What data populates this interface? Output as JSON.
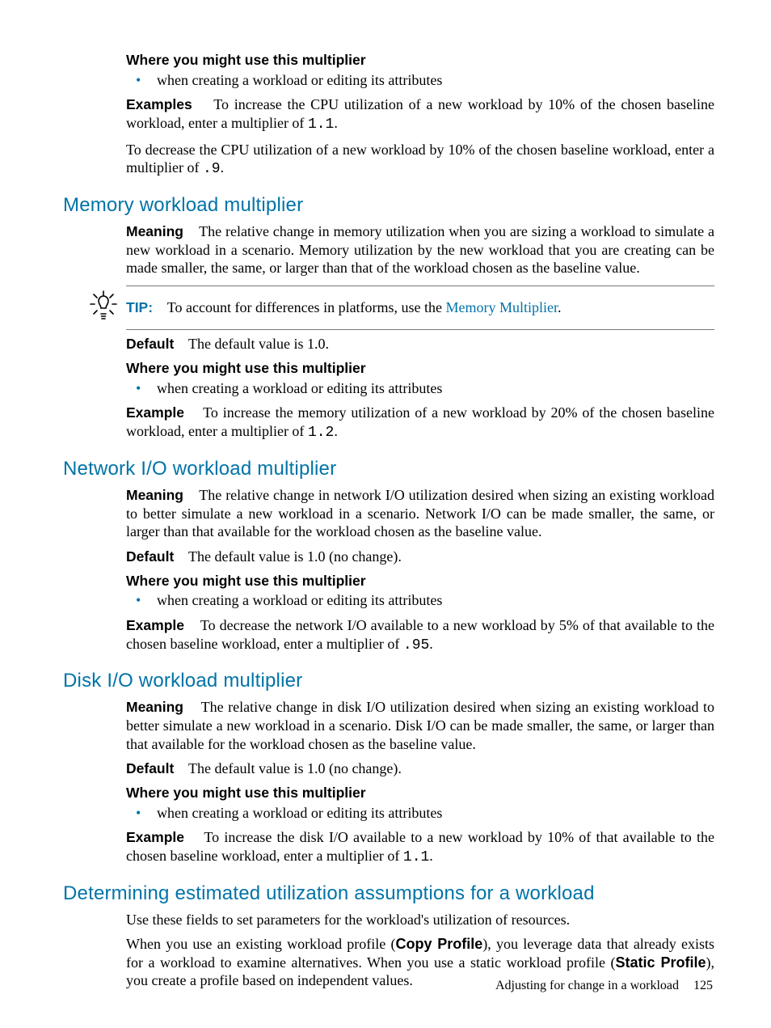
{
  "intro": {
    "where_head": "Where you might use this multiplier",
    "where_bullet": "when creating a workload or editing its attributes",
    "examples_label": "Examples",
    "examples_text_a": "To increase the CPU utilization of a new workload by 10% of the chosen baseline workload, enter a multiplier of ",
    "examples_code_a": "1.1",
    "examples_text_b": ".",
    "examples2_a": "To decrease the CPU utilization of a new workload by 10% of the chosen baseline workload, enter a multiplier of ",
    "examples2_code": ".9",
    "examples2_b": "."
  },
  "memory": {
    "heading": "Memory workload multiplier",
    "meaning_label": "Meaning",
    "meaning_text": "The relative change in memory utilization when you are sizing a workload to simulate a new workload in a scenario. Memory utilization by the new workload that you are creating can be made smaller, the same, or larger than that of the workload chosen as the baseline value.",
    "tip_label": "TIP:",
    "tip_text_a": "To account for differences in platforms, use the ",
    "tip_link": "Memory Multiplier",
    "tip_text_b": ".",
    "default_label": "Default",
    "default_text": "The default value is 1.0.",
    "where_head": "Where you might use this multiplier",
    "where_bullet": "when creating a workload or editing its attributes",
    "example_label": "Example",
    "example_text_a": "To increase the memory utilization of a new workload by 20% of the chosen baseline workload, enter a multiplier of ",
    "example_code": "1.2",
    "example_text_b": "."
  },
  "network": {
    "heading": "Network I/O workload multiplier",
    "meaning_label": "Meaning",
    "meaning_text": "The relative change in network I/O utilization desired when sizing an existing workload to better simulate a new workload in a scenario. Network I/O can be made smaller, the same, or larger than that available for the workload chosen as the baseline value.",
    "default_label": "Default",
    "default_text": "The default value is 1.0 (no change).",
    "where_head": "Where you might use this multiplier",
    "where_bullet": "when creating a workload or editing its attributes",
    "example_label": "Example",
    "example_text_a": "To decrease the network I/O available to a new workload by 5% of that available to the chosen baseline workload, enter a multiplier of ",
    "example_code": ".95",
    "example_text_b": "."
  },
  "disk": {
    "heading": "Disk I/O workload multiplier",
    "meaning_label": "Meaning",
    "meaning_text": "The relative change in disk I/O utilization desired when sizing an existing workload to better simulate a new workload in a scenario. Disk I/O can be made smaller, the same, or larger than that available for the workload chosen as the baseline value.",
    "default_label": "Default",
    "default_text": "The default value is 1.0 (no change).",
    "where_head": "Where you might use this multiplier",
    "where_bullet": "when creating a workload or editing its attributes",
    "example_label": "Example",
    "example_text_a": "To increase the disk I/O available to a new workload by 10% of that available to the chosen baseline workload, enter a multiplier of ",
    "example_code": "1.1",
    "example_text_b": "."
  },
  "determining": {
    "heading": "Determining estimated utilization assumptions for a workload",
    "p1": "Use these fields to set parameters for the workload's utilization of resources.",
    "p2_a": "When you use an existing workload profile (",
    "p2_bold1": "Copy Profile",
    "p2_b": "), you leverage data that already exists for a workload to examine alternatives. When you use a static workload profile (",
    "p2_bold2": "Static Profile",
    "p2_c": "), you create a profile based on independent values."
  },
  "footer": {
    "text": "Adjusting for change in a workload",
    "page": "125"
  }
}
